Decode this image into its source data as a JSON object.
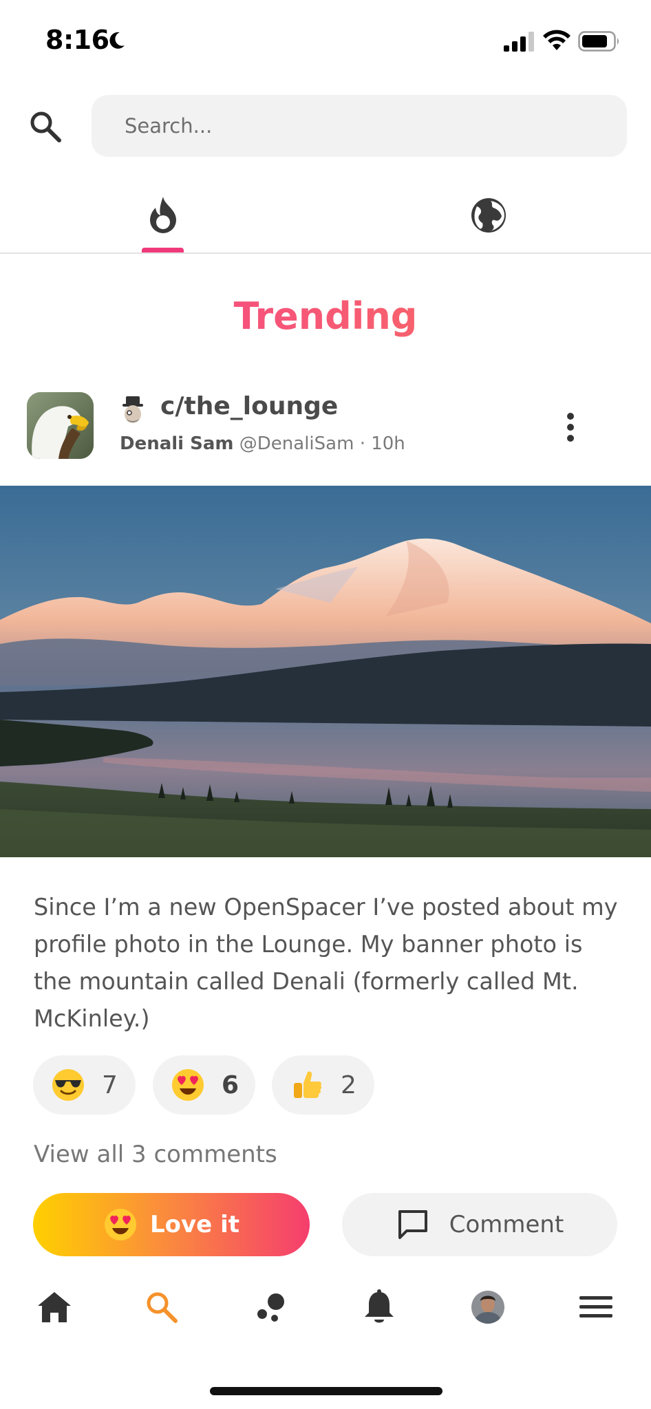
{
  "status_bar": {
    "time": "8:16",
    "icons": [
      "moon-icon",
      "signal-icon",
      "wifi-icon",
      "battery-icon"
    ]
  },
  "search": {
    "placeholder": "Search...",
    "value": ""
  },
  "tabs": [
    {
      "name": "trending",
      "icon": "flame-icon",
      "active": true
    },
    {
      "name": "global",
      "icon": "globe-icon",
      "active": false
    }
  ],
  "section_title": "Trending",
  "post": {
    "community": "c/the_lounge",
    "author_name": "Denali Sam",
    "author_handle": "@DenaliSam",
    "time_ago": "· 10h",
    "text": "Since I’m a new OpenSpacer I’ve posted about my profile photo in the Lounge. My banner photo is the mountain called Denali (formerly called Mt. McKinley.)",
    "reactions": [
      {
        "icon": "sunglasses-emoji-icon",
        "count": "7"
      },
      {
        "icon": "heart-eyes-emoji-icon",
        "count": "6"
      },
      {
        "icon": "thumbs-up-emoji-icon",
        "count": "2"
      }
    ],
    "view_comments": "View all 3 comments",
    "love_label": "Love it",
    "comment_label": "Comment"
  },
  "bottom_nav": [
    {
      "name": "home",
      "icon": "home-icon",
      "active": false
    },
    {
      "name": "search",
      "icon": "search-icon",
      "active": true
    },
    {
      "name": "communities",
      "icon": "communities-icon",
      "active": false
    },
    {
      "name": "notifications",
      "icon": "bell-icon",
      "active": false
    },
    {
      "name": "profile",
      "icon": "avatar-icon",
      "active": false
    },
    {
      "name": "menu",
      "icon": "hamburger-icon",
      "active": false
    }
  ],
  "colors": {
    "accent": "#f0397a",
    "nav_active": "#f5922b",
    "love_gradient_start": "#ffd000",
    "love_gradient_end": "#f53e6e"
  }
}
